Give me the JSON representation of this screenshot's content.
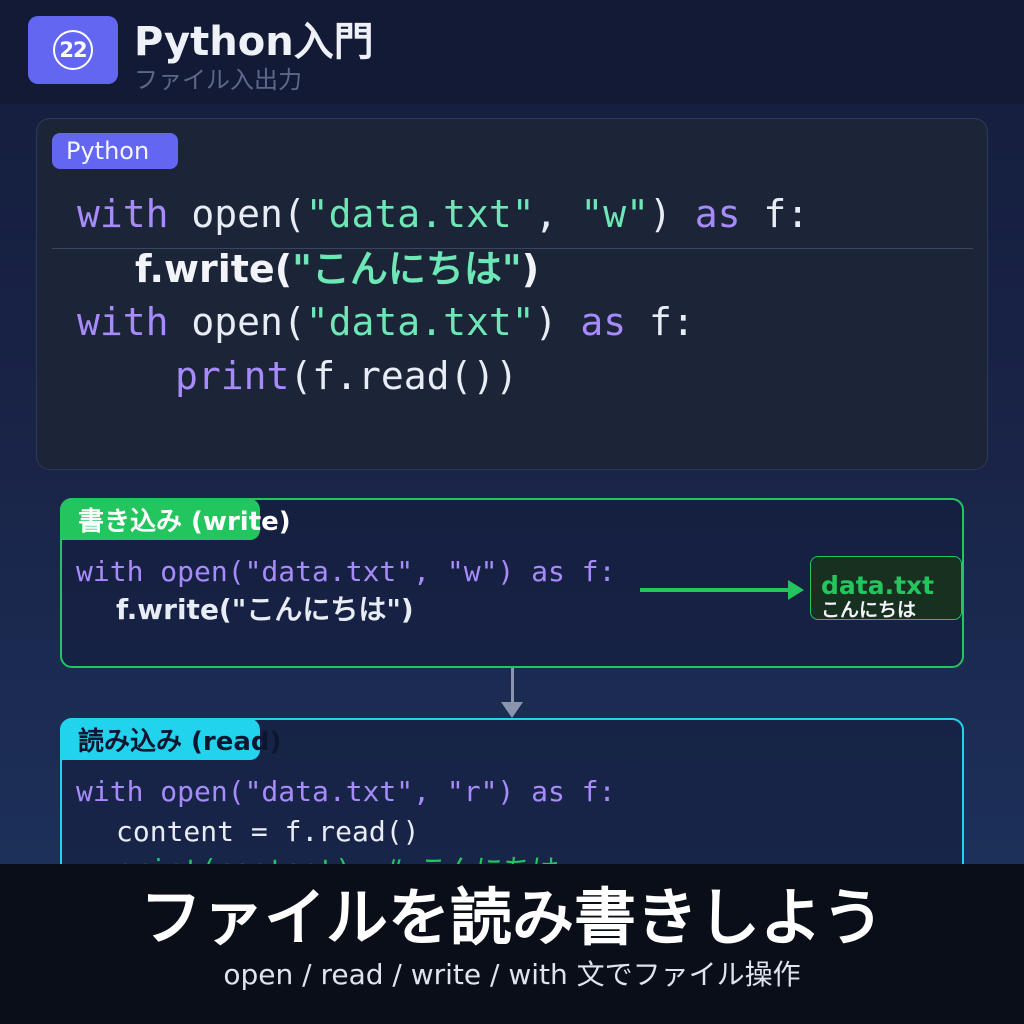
{
  "header": {
    "episode_badge": "22",
    "title": "Python入門",
    "subtitle": "ファイル入出力"
  },
  "code_panel": {
    "language_tag": "Python",
    "line1": {
      "kw_with": "with",
      "call": "open(",
      "arg1": "\"data.txt\"",
      "sep": ", ",
      "arg2": "\"w\"",
      "close": ")",
      "kw_as": "as",
      "target": "f:"
    },
    "line2": {
      "call_start": "f.write(",
      "arg": "\"こんにちは\"",
      "call_end": ")"
    },
    "line3": {
      "kw_with": "with",
      "call": "open(",
      "arg1": "\"data.txt\"",
      "close": ")",
      "kw_as": "as",
      "target": "f:"
    },
    "line4": {
      "kw_print": "print",
      "rest": "(f.read())"
    }
  },
  "write_section": {
    "label": "書き込み (write)",
    "code_line1": "with open(\"data.txt\", \"w\") as f:",
    "code_line2": "f.write(\"こんにちは\")",
    "file_name": "data.txt",
    "file_content": "こんにちは"
  },
  "read_section": {
    "label": "読み込み (read)",
    "code_line1": "with open(\"data.txt\", \"r\") as f:",
    "code_line2": "content = f.read()",
    "code_line3": "print(content)  # こんにちは"
  },
  "banner": {
    "title": "ファイルを読み書きしよう",
    "subtitle": "open / read / write / with 文でファイル操作"
  },
  "colors": {
    "accent": "#6366f1",
    "write": "#22c55e",
    "read": "#22d3ee",
    "keyword": "#a78bfa",
    "string": "#6ee7b7"
  }
}
